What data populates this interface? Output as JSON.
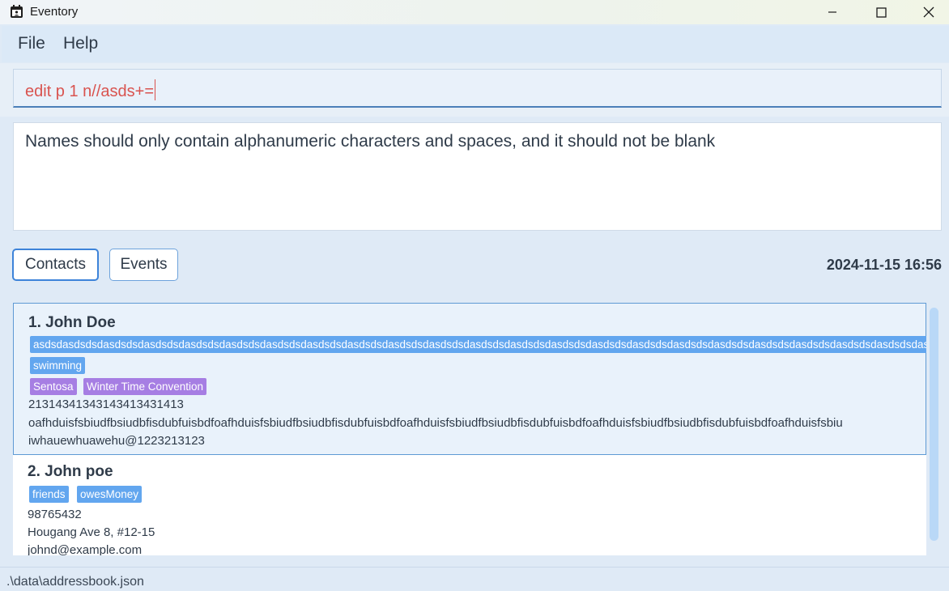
{
  "window": {
    "title": "Eventory"
  },
  "menu": {
    "items": [
      "File",
      "Help"
    ]
  },
  "command": {
    "value": "edit p 1 n//asds+="
  },
  "result": {
    "text": "Names should only contain alphanumeric characters and spaces, and it should not be blank"
  },
  "tabs": [
    {
      "label": "Contacts",
      "active": true
    },
    {
      "label": "Events",
      "active": false
    }
  ],
  "datetime": "2024-11-15 16:56",
  "contacts": [
    {
      "name": "1. John Doe",
      "long_tag": "asdsdasdsdsdasdsdsdasdsdsdasdsdsdasdsdsdasdsdsdasdsdsdasdsdsdasdsdsdasdsdsdasdsdsdasdsdsdasdsdsdasdsdsdasdsdsdasdsdsdasdsdsdasdsdsdasdsdsdasdsdsdasdsdsdasdsdsdasdsdsdasdsdsdasdsdsda",
      "tags": [
        "swimming"
      ],
      "events": [
        "Sentosa",
        "Winter Time Convention"
      ],
      "phone": "21314341343143413431413",
      "address": "oafhduisfsbiudfbsiudbfisdubfuisbdfoafhduisfsbiudfbsiudbfisdubfuisbdfoafhduisfsbiudfbsiudbfisdubfuisbdfoafhduisfsbiudfbsiudbfisdubfuisbdfoafhduisfsbiu",
      "email": "iwhauewhuawehu@1223213123"
    },
    {
      "name": "2. John poe",
      "tags": [
        "friends",
        "owesMoney"
      ],
      "phone": "98765432",
      "address": "Hougang Ave 8, #12-15",
      "email": "johnd@example.com"
    }
  ],
  "status": {
    "path": ".\\data\\addressbook.json"
  },
  "colors": {
    "tag_blue": "#62a6ef",
    "tag_purple": "#a67ee3",
    "error_text": "#d9534f",
    "accent": "#3d83d9"
  }
}
